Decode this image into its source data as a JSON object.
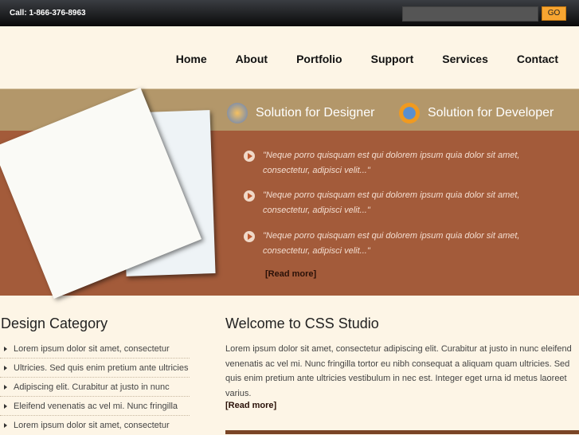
{
  "header": {
    "call": "Call: 1-866-376-8963",
    "search_placeholder": "",
    "go": "GO"
  },
  "nav": [
    "Home",
    "About",
    "Portfolio",
    "Support",
    "Services",
    "Contact"
  ],
  "banner": {
    "designer": "Solution for Designer",
    "developer": "Solution for Developer",
    "quotes": [
      "\"Neque porro quisquam est qui dolorem ipsum quia dolor sit amet, consectetur, adipisci velit...\"",
      "\"Neque porro quisquam est qui dolorem ipsum quia dolor sit amet, consectetur, adipisci velit...\"",
      "\"Neque porro quisquam est qui dolorem ipsum quia dolor sit amet, consectetur, adipisci velit...\""
    ],
    "read_more": "[Read more]"
  },
  "category": {
    "title": "Design Category",
    "items": [
      "Lorem ipsum dolor sit amet, consectetur",
      "Ultricies. Sed quis enim pretium ante ultricies",
      "Adipiscing elit. Curabitur at justo in nunc",
      "Eleifend venenatis ac vel mi. Nunc fringilla",
      "Lorem ipsum dolor sit amet, consectetur"
    ]
  },
  "welcome": {
    "title": "Welcome to CSS Studio",
    "text": "Lorem ipsum dolor sit amet, consectetur adipiscing elit. Curabitur at justo in nunc eleifend venenatis ac vel mi. Nunc fringilla tortor eu nibh consequat a aliquam quam ultricies. Sed quis enim pretium ante ultricies vestibulum in nec est. Integer eget urna id metus laoreet varius.",
    "read_more": "[Read more]"
  }
}
